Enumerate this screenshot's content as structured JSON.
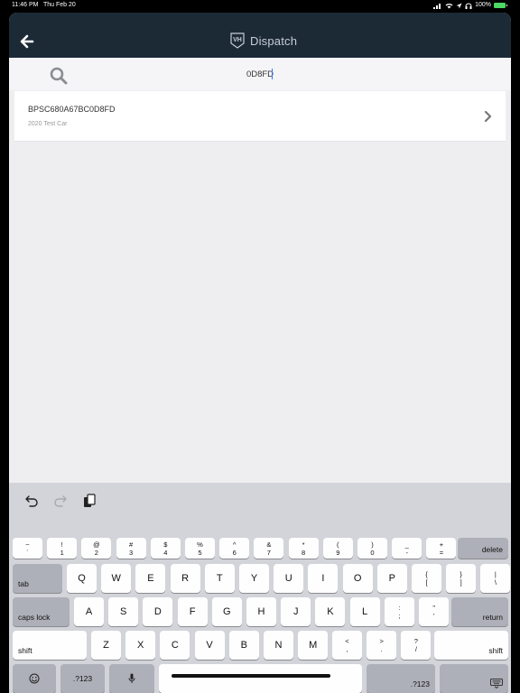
{
  "status": {
    "time": "11:46 PM",
    "date": "Thu Feb 20",
    "battery": "100%"
  },
  "nav": {
    "title": "Dispatch",
    "logo_text": "VH"
  },
  "search": {
    "value": "0D8FD"
  },
  "results": [
    {
      "title": "BPSC680A67BC0D8FD",
      "subtitle": "2020 Test Car"
    }
  ],
  "keyboard": {
    "number_row": [
      [
        "~",
        "`"
      ],
      [
        "!",
        "1"
      ],
      [
        "@",
        "2"
      ],
      [
        "#",
        "3"
      ],
      [
        "$",
        "4"
      ],
      [
        "%",
        "5"
      ],
      [
        "^",
        "6"
      ],
      [
        "&",
        "7"
      ],
      [
        "*",
        "8"
      ],
      [
        "(",
        "9"
      ],
      [
        ")",
        "0"
      ],
      [
        "_",
        "-"
      ],
      [
        "+",
        "="
      ]
    ],
    "row1": [
      "Q",
      "W",
      "E",
      "R",
      "T",
      "Y",
      "U",
      "I",
      "O",
      "P"
    ],
    "row1_extra": [
      [
        "{",
        "["
      ],
      [
        "}",
        "]"
      ],
      [
        "|",
        "\\"
      ]
    ],
    "row2": [
      "A",
      "S",
      "D",
      "F",
      "G",
      "H",
      "J",
      "K",
      "L"
    ],
    "row2_extra": [
      [
        ":",
        ";"
      ],
      [
        "\"",
        "'"
      ]
    ],
    "row3": [
      "Z",
      "X",
      "C",
      "V",
      "B",
      "N",
      "M"
    ],
    "row3_extra": [
      [
        "<",
        ","
      ],
      [
        ">",
        "."
      ],
      [
        "?",
        "/"
      ]
    ],
    "labels": {
      "delete": "delete",
      "tab": "tab",
      "caps": "caps lock",
      "return": "return",
      "shift": "shift",
      "numbers": ".?123"
    }
  }
}
